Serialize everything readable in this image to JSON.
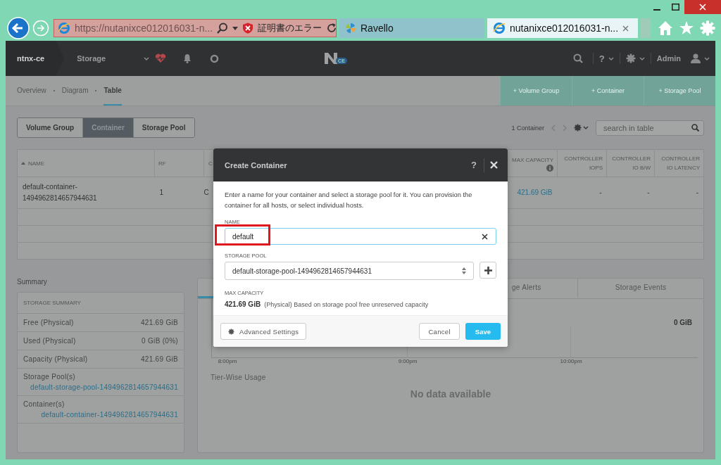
{
  "browser": {
    "address": "https://nutanixce012016031-n...",
    "cert_error": "証明書のエラー",
    "tabs": [
      {
        "title": "Ravello",
        "selected": false
      },
      {
        "title": "nutanixce012016031-n...",
        "selected": true
      }
    ]
  },
  "nav": {
    "cluster": "ntnx-ce",
    "section": "Storage",
    "logo_badge": "CE",
    "help": "?",
    "user": "Admin"
  },
  "views": [
    {
      "label": "Overview",
      "selected": false
    },
    {
      "label": "Diagram",
      "selected": false
    },
    {
      "label": "Table",
      "selected": true
    }
  ],
  "actions": [
    "+ Volume Group",
    "+ Container",
    "+ Storage Pool"
  ],
  "entity_tabs": [
    {
      "label": "Volume Group",
      "selected": false
    },
    {
      "label": "Container",
      "selected": true
    },
    {
      "label": "Storage Pool",
      "selected": false
    }
  ],
  "table_toolbar": {
    "count": "1 Container",
    "search_placeholder": "search in table"
  },
  "table": {
    "columns": [
      {
        "label": "NAME",
        "sorted": true,
        "info": false
      },
      {
        "label": "RF",
        "sorted": false,
        "info": false
      },
      {
        "label": "C",
        "sorted": false,
        "info": false
      },
      {
        "label": "MAX CAPACITY",
        "sorted": false,
        "info": true
      },
      {
        "label": "CONTROLLER IOPS",
        "sorted": false,
        "info": false
      },
      {
        "label": "CONTROLLER IO B/W",
        "sorted": false,
        "info": false
      },
      {
        "label": "CONTROLLER IO LATENCY",
        "sorted": false,
        "info": false
      }
    ],
    "rows": [
      {
        "cells": [
          "default-container-1494962814657944631",
          "1",
          "C",
          "421.69 GiB",
          "-",
          "-",
          "-"
        ]
      }
    ]
  },
  "summary": {
    "title": "Summary",
    "card_title": "STORAGE SUMMARY",
    "rows": [
      {
        "label": "Free (Physical)",
        "value": "421.69 GiB"
      },
      {
        "label": "Used (Physical)",
        "value": "0 GiB (0%)"
      },
      {
        "label": "Capacity (Physical)",
        "value": "421.69 GiB"
      }
    ],
    "links": [
      {
        "label": "Storage Pool(s)",
        "value": "default-storage-pool-1494962814657944631"
      },
      {
        "label": "Container(s)",
        "value": "default-container-1494962814657944631"
      }
    ]
  },
  "performance": {
    "tabs": [
      {
        "selected": true
      },
      {
        "label": "ge Alerts",
        "selected": false
      },
      {
        "label": "Storage Events",
        "selected": false
      }
    ],
    "y_value": "0 GiB",
    "x_labels": [
      "8:00pm",
      "9:00pm",
      "10:00pm"
    ],
    "tier_title": "Tier-Wise Usage",
    "empty": "No data available"
  },
  "dialog": {
    "title": "Create Container",
    "help": "?",
    "description": "Enter a name for your container and select a storage pool for it. You can provision the container for all hosts, or select individual hosts.",
    "name_label": "NAME",
    "name_value": "default",
    "pool_label": "STORAGE POOL",
    "pool_value": "default-storage-pool-1494962814657944631",
    "capacity_label": "MAX CAPACITY",
    "capacity_value": "421.69 GiB",
    "capacity_note": "(Physical) Based on storage pool free unreserved capacity",
    "advanced": "Advanced Settings",
    "cancel": "Cancel",
    "save": "Save"
  }
}
